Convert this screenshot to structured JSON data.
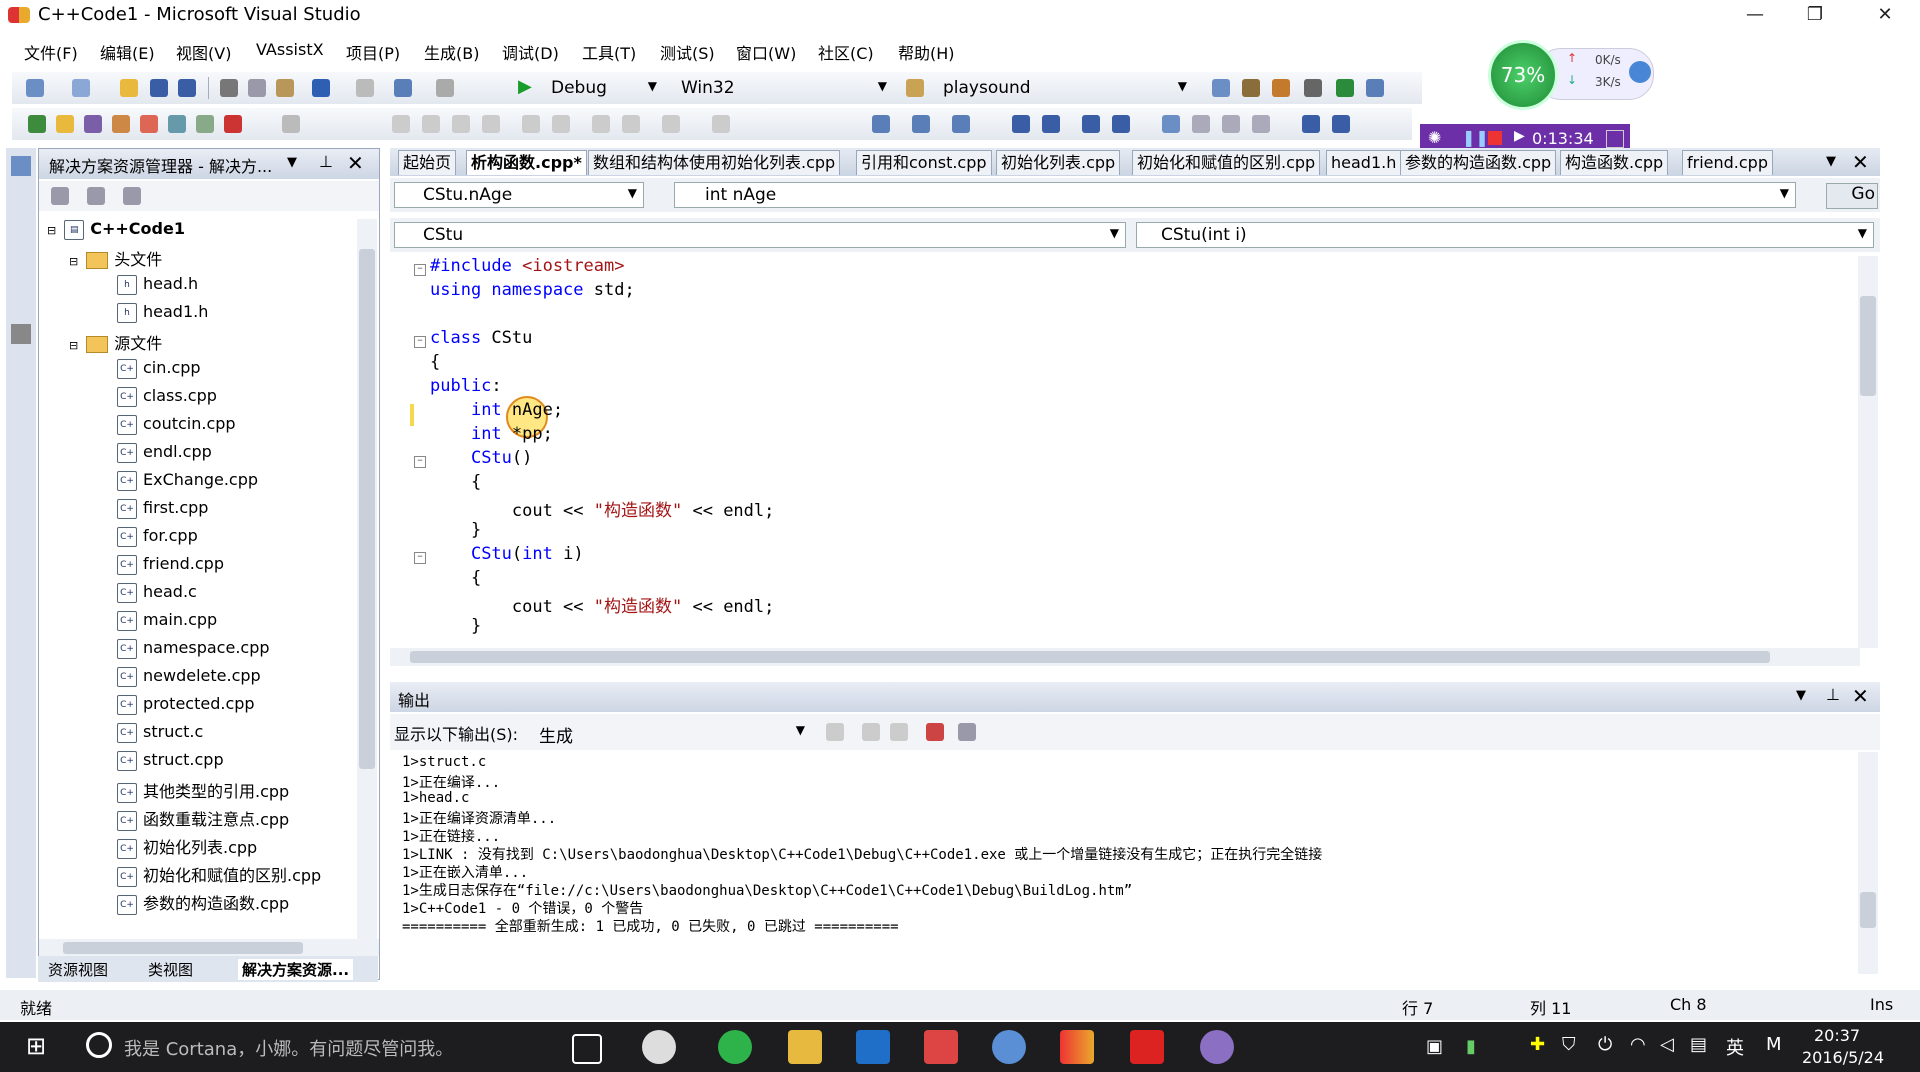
{
  "window": {
    "title": "C++Code1 - Microsoft Visual Studio"
  },
  "menu": [
    "文件(F)",
    "编辑(E)",
    "视图(V)",
    "VAssistX",
    "项目(P)",
    "生成(B)",
    "调试(D)",
    "工具(T)",
    "测试(S)",
    "窗口(W)",
    "社区(C)",
    "帮助(H)"
  ],
  "toolbar": {
    "config": "Debug",
    "platform": "Win32",
    "find": "playsound"
  },
  "perf": {
    "cpu": "73%",
    "up": "0K/s",
    "down": "3K/s"
  },
  "recorder": {
    "time": "0:13:34"
  },
  "solution_explorer": {
    "title": "解决方案资源管理器 - 解决方...",
    "root": "C++Code1",
    "header_folder": "头文件",
    "headers": [
      "head.h",
      "head1.h"
    ],
    "source_folder": "源文件",
    "sources": [
      "cin.cpp",
      "class.cpp",
      "coutcin.cpp",
      "endl.cpp",
      "ExChange.cpp",
      "first.cpp",
      "for.cpp",
      "friend.cpp",
      "head.c",
      "main.cpp",
      "namespace.cpp",
      "newdelete.cpp",
      "protected.cpp",
      "struct.c",
      "struct.cpp",
      "其他类型的引用.cpp",
      "函数重载注意点.cpp",
      "初始化列表.cpp",
      "初始化和赋值的区别.cpp",
      "参数的构造函数.cpp"
    ],
    "tabs": [
      "资源视图",
      "类视图",
      "解决方案资源..."
    ]
  },
  "doc_tabs": [
    "起始页",
    "析构函数.cpp*",
    "数组和结构体使用初始化列表.cpp",
    "引用和const.cpp",
    "初始化列表.cpp",
    "初始化和赋值的区别.cpp",
    "head1.h",
    "参数的构造函数.cpp",
    "构造函数.cpp",
    "friend.cpp"
  ],
  "nav": {
    "member": "CStu.nAge",
    "member_decl": "int nAge",
    "go": "Go",
    "scope": "CStu",
    "function": "CStu(int i)"
  },
  "code": [
    "#include <iostream>",
    "using namespace std;",
    "",
    "class CStu",
    "{",
    "public:",
    "    int nAge;",
    "    int *pp;",
    "    CStu()",
    "    {",
    "        cout << \"构造函数\" << endl;",
    "    }",
    "    CStu(int i)",
    "    {",
    "        cout << \"构造函数\" << endl;",
    "    }"
  ],
  "output": {
    "title": "输出",
    "show_label": "显示以下输出(S):",
    "source": "生成",
    "lines": [
      "1>struct.c",
      "1>正在编译...",
      "1>head.c",
      "1>正在编译资源清单...",
      "1>正在链接...",
      "1>LINK : 没有找到 C:\\Users\\baodonghua\\Desktop\\C++Code1\\Debug\\C++Code1.exe 或上一个增量链接没有生成它；正在执行完全链接",
      "1>正在嵌入清单...",
      "1>生成日志保存在“file://c:\\Users\\baodonghua\\Desktop\\C++Code1\\C++Code1\\Debug\\BuildLog.htm”",
      "1>C++Code1 - 0 个错误，0 个警告",
      "========== 全部重新生成: 1 已成功, 0 已失败, 0 已跳过 =========="
    ]
  },
  "status": {
    "ready": "就绪",
    "line": "行 7",
    "col": "列 11",
    "ch": "Ch 8",
    "ins": "Ins"
  },
  "taskbar": {
    "cortana": "我是 Cortana，小娜。有问题尽管问我。",
    "time": "20:37",
    "date": "2016/5/24",
    "ime": "英"
  }
}
